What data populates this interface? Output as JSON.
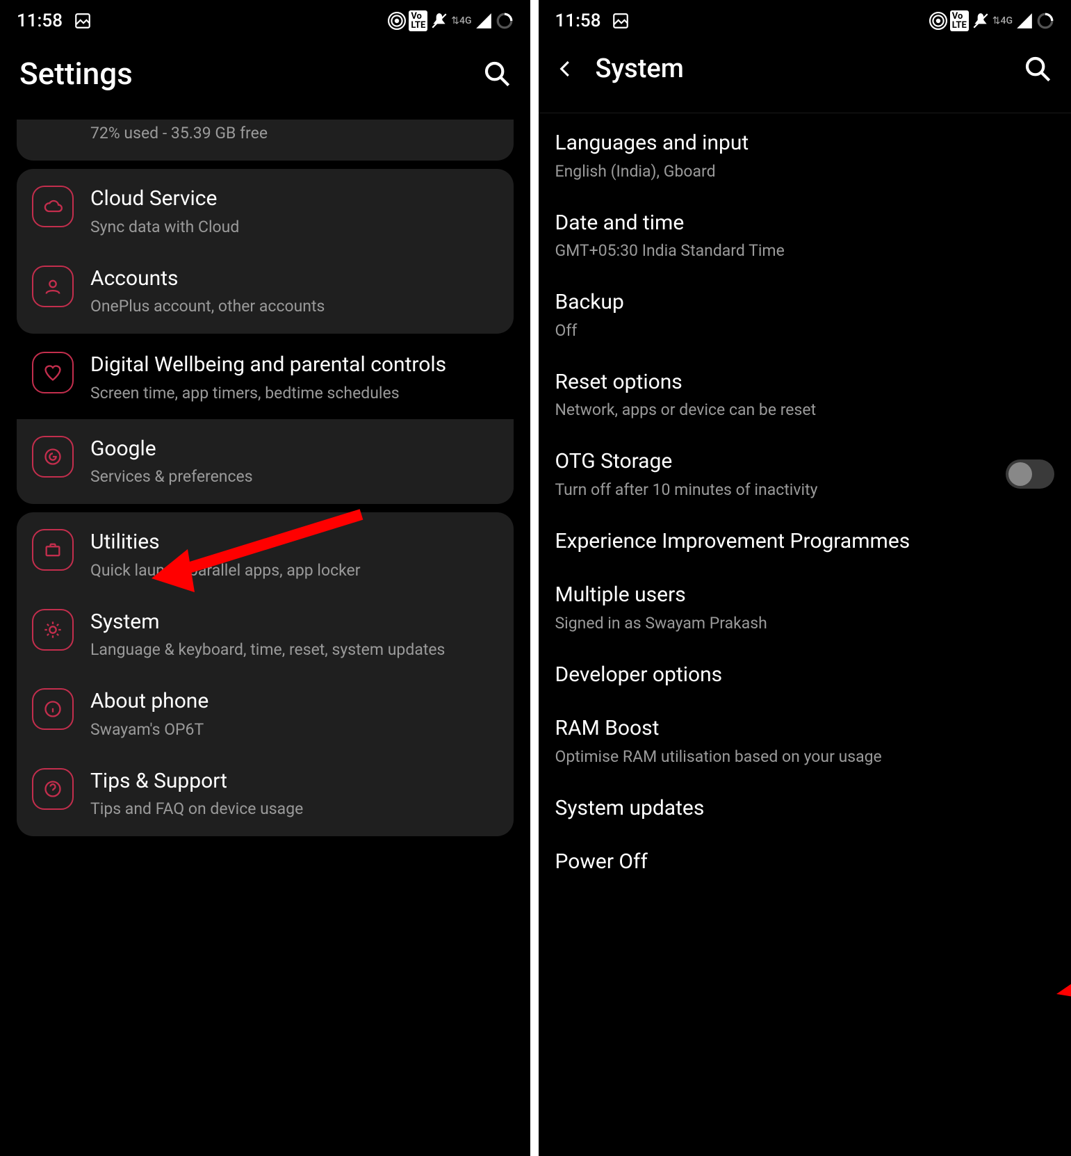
{
  "status": {
    "time": "11:58",
    "icons": [
      "hotspot",
      "volte",
      "mute",
      "4g",
      "signal",
      "loading"
    ]
  },
  "left": {
    "title": "Settings",
    "storage_peek": "72% used - 35.39 GB free",
    "groups": [
      {
        "items": [
          {
            "icon": "cloud",
            "title": "Cloud Service",
            "sub": "Sync data with Cloud"
          },
          {
            "icon": "account",
            "title": "Accounts",
            "sub": "OnePlus account, other accounts"
          }
        ]
      },
      {
        "items": [
          {
            "icon": "heart",
            "title": "Digital Wellbeing and parental controls",
            "sub": "Screen time, app timers, bedtime schedules"
          },
          {
            "icon": "google",
            "title": "Google",
            "sub": "Services & preferences"
          }
        ],
        "split_bg": true
      },
      {
        "items": [
          {
            "icon": "briefcase",
            "title": "Utilities",
            "sub": "Quick launch, parallel apps, app locker"
          },
          {
            "icon": "gear",
            "title": "System",
            "sub": "Language & keyboard, time, reset, system updates"
          },
          {
            "icon": "info",
            "title": "About phone",
            "sub": "Swayam's OP6T"
          },
          {
            "icon": "help",
            "title": "Tips & Support",
            "sub": "Tips and FAQ on device usage"
          }
        ]
      }
    ]
  },
  "right": {
    "title": "System",
    "items": [
      {
        "title": "Languages and input",
        "sub": "English (India), Gboard"
      },
      {
        "title": "Date and time",
        "sub": "GMT+05:30 India Standard Time"
      },
      {
        "title": "Backup",
        "sub": "Off"
      },
      {
        "title": "Reset options",
        "sub": "Network, apps or device can be reset"
      },
      {
        "title": "OTG Storage",
        "sub": "Turn off after 10 minutes of inactivity",
        "toggle": false
      },
      {
        "title": "Experience Improvement Programmes"
      },
      {
        "title": "Multiple users",
        "sub": "Signed in as Swayam Prakash"
      },
      {
        "title": "Developer options"
      },
      {
        "title": "RAM Boost",
        "sub": "Optimise RAM utilisation based on your usage"
      },
      {
        "title": "System updates"
      },
      {
        "title": "Power Off"
      }
    ]
  }
}
